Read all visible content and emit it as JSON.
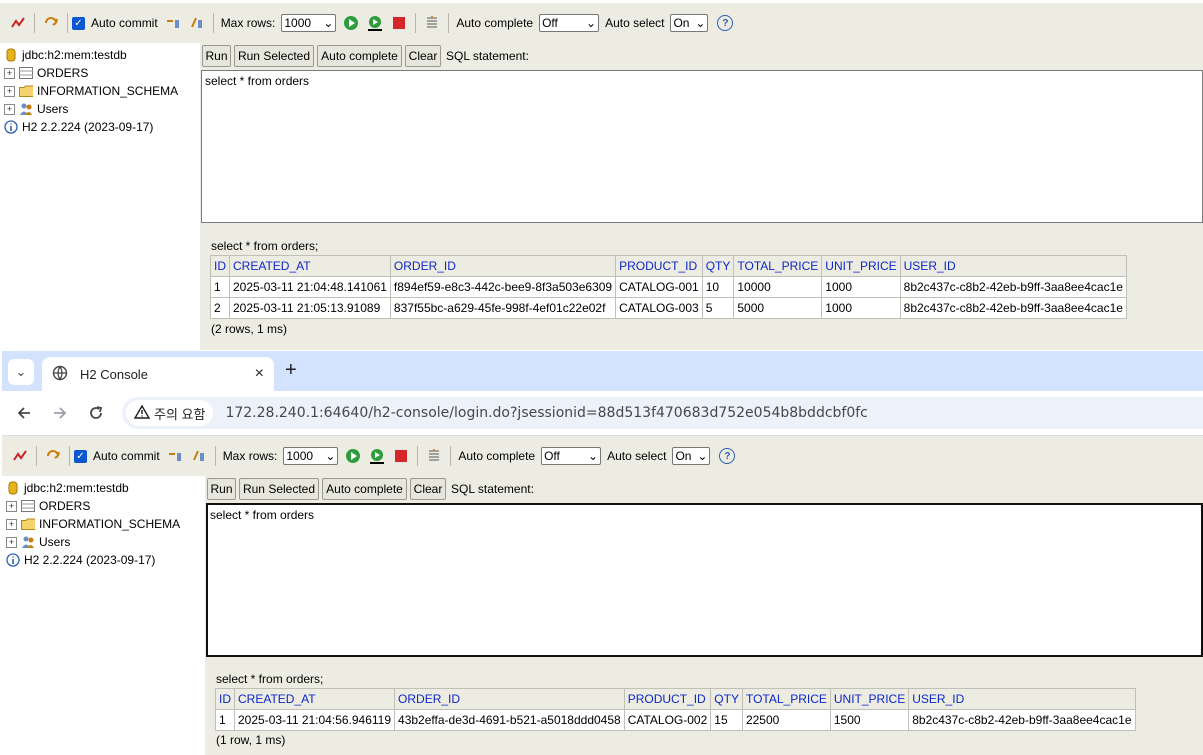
{
  "toolbar": {
    "auto_commit_label": "Auto commit",
    "max_rows_label": "Max rows:",
    "max_rows_value": "1000",
    "auto_complete_label": "Auto complete",
    "auto_complete_value": "Off",
    "auto_select_label": "Auto select",
    "auto_select_value": "On",
    "help_symbol": "?"
  },
  "tree": {
    "connection": "jdbc:h2:mem:testdb",
    "items": [
      {
        "label": "ORDERS",
        "icon": "table-icon"
      },
      {
        "label": "INFORMATION_SCHEMA",
        "icon": "folder-icon"
      },
      {
        "label": "Users",
        "icon": "users-icon"
      }
    ],
    "version": "H2 2.2.224 (2023-09-17)"
  },
  "query": {
    "buttons": {
      "run": "Run",
      "run_selected": "Run Selected",
      "auto_complete": "Auto complete",
      "clear": "Clear"
    },
    "sql_label": "SQL statement:",
    "sql_text": "select * from orders"
  },
  "columns": [
    "ID",
    "CREATED_AT",
    "ORDER_ID",
    "PRODUCT_ID",
    "QTY",
    "TOTAL_PRICE",
    "UNIT_PRICE",
    "USER_ID"
  ],
  "window1": {
    "result_sql": "select * from orders;",
    "rows": [
      [
        "1",
        "2025-03-11 21:04:48.141061",
        "f894ef59-e8c3-442c-bee9-8f3a503e6309",
        "CATALOG-001",
        "10",
        "10000",
        "1000",
        "8b2c437c-c8b2-42eb-b9ff-3aa8ee4cac1e"
      ],
      [
        "2",
        "2025-03-11 21:05:13.91089",
        "837f55bc-a629-45fe-998f-4ef01c22e02f",
        "CATALOG-003",
        "5",
        "5000",
        "1000",
        "8b2c437c-c8b2-42eb-b9ff-3aa8ee4cac1e"
      ]
    ],
    "footer": "(2 rows, 1 ms)"
  },
  "browser": {
    "tab_title": "H2 Console",
    "new_tab_symbol": "+",
    "close_symbol": "×",
    "warning_label": "주의 요함",
    "url": "172.28.240.1:64640/h2-console/login.do?jsessionid=88d513f470683d752e054b8bddcbf0fc"
  },
  "window2": {
    "result_sql": "select * from orders;",
    "rows": [
      [
        "1",
        "2025-03-11 21:04:56.946119",
        "43b2effa-de3d-4691-b521-a5018ddd0458",
        "CATALOG-002",
        "15",
        "22500",
        "1500",
        "8b2c437c-c8b2-42eb-b9ff-3aa8ee4cac1e"
      ]
    ],
    "footer": "(1 row, 1 ms)"
  },
  "colors": {
    "header_link": "#0d27c9",
    "panel_bg": "#ecece2",
    "chrome_tabstrip": "#d3e3fd"
  }
}
